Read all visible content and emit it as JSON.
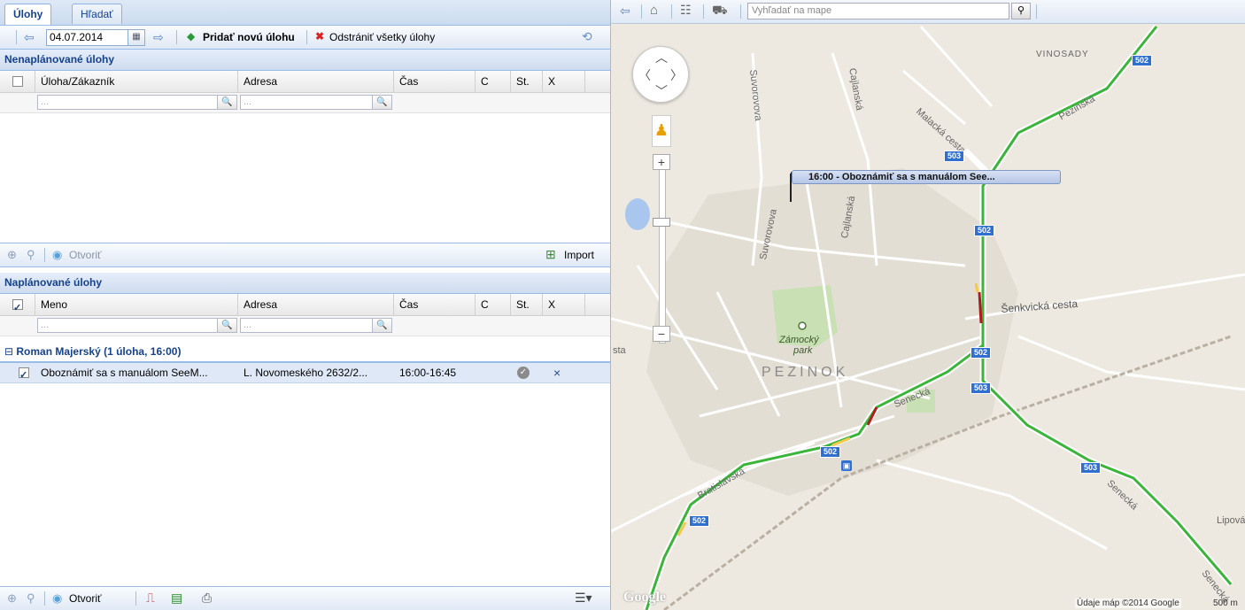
{
  "tabs": [
    {
      "label": "Úlohy",
      "active": true
    },
    {
      "label": "Hľadať",
      "active": false
    }
  ],
  "toolbar": {
    "date_value": "04.07.2014",
    "add_label": "Pridať novú úlohu",
    "remove_label": "Odstrániť všetky úlohy"
  },
  "unplanned": {
    "title": "Nenaplánované úlohy",
    "columns": [
      "Úloha/Zákazník",
      "Adresa",
      "Čas",
      "C",
      "St.",
      "X"
    ],
    "filter_placeholder": "...",
    "open_label": "Otvoriť",
    "import_label": "Import"
  },
  "planned": {
    "title": "Naplánované úlohy",
    "columns": [
      "Meno",
      "Adresa",
      "Čas",
      "C",
      "St.",
      "X"
    ],
    "filter_placeholder": "...",
    "group_label": "Roman Majerský (1 úloha, 16:00)",
    "rows": [
      {
        "task": "Oboznámiť sa s manuálom SeeM...",
        "address": "L. Novomeského 2632/2...",
        "time": "16:00-16:45",
        "delete": "×"
      }
    ],
    "open_label": "Otvoriť"
  },
  "map": {
    "search_placeholder": "Vyhľadať na mape",
    "marker_label": "16:00 - Oboznámiť sa s manuálom See...",
    "labels": {
      "vinosady": "VINOSADY",
      "pezinok": "PEZINOK",
      "zamocky": "Zámocký",
      "park": "park",
      "malacka": "Malacká cesta",
      "pezinska": "Pezinská",
      "cajlanska1": "Cajlanská",
      "cajlanska2": "Cajlanská",
      "suvorovova1": "Suvorovova",
      "suvorovova2": "Suvorovova",
      "senkvicka": "Šenkvická cesta",
      "senecka1": "Senecká",
      "senecka2": "Senecká",
      "senecka3": "Senecká",
      "bratislavska": "Bratislavská",
      "lipova": "Lipová",
      "sta": "sta",
      "google": "Google",
      "copyright": "Údaje máp ©2014 Google",
      "scale": "500 m"
    },
    "shields": [
      "502",
      "503",
      "502",
      "502",
      "503",
      "502",
      "503",
      "502"
    ]
  }
}
